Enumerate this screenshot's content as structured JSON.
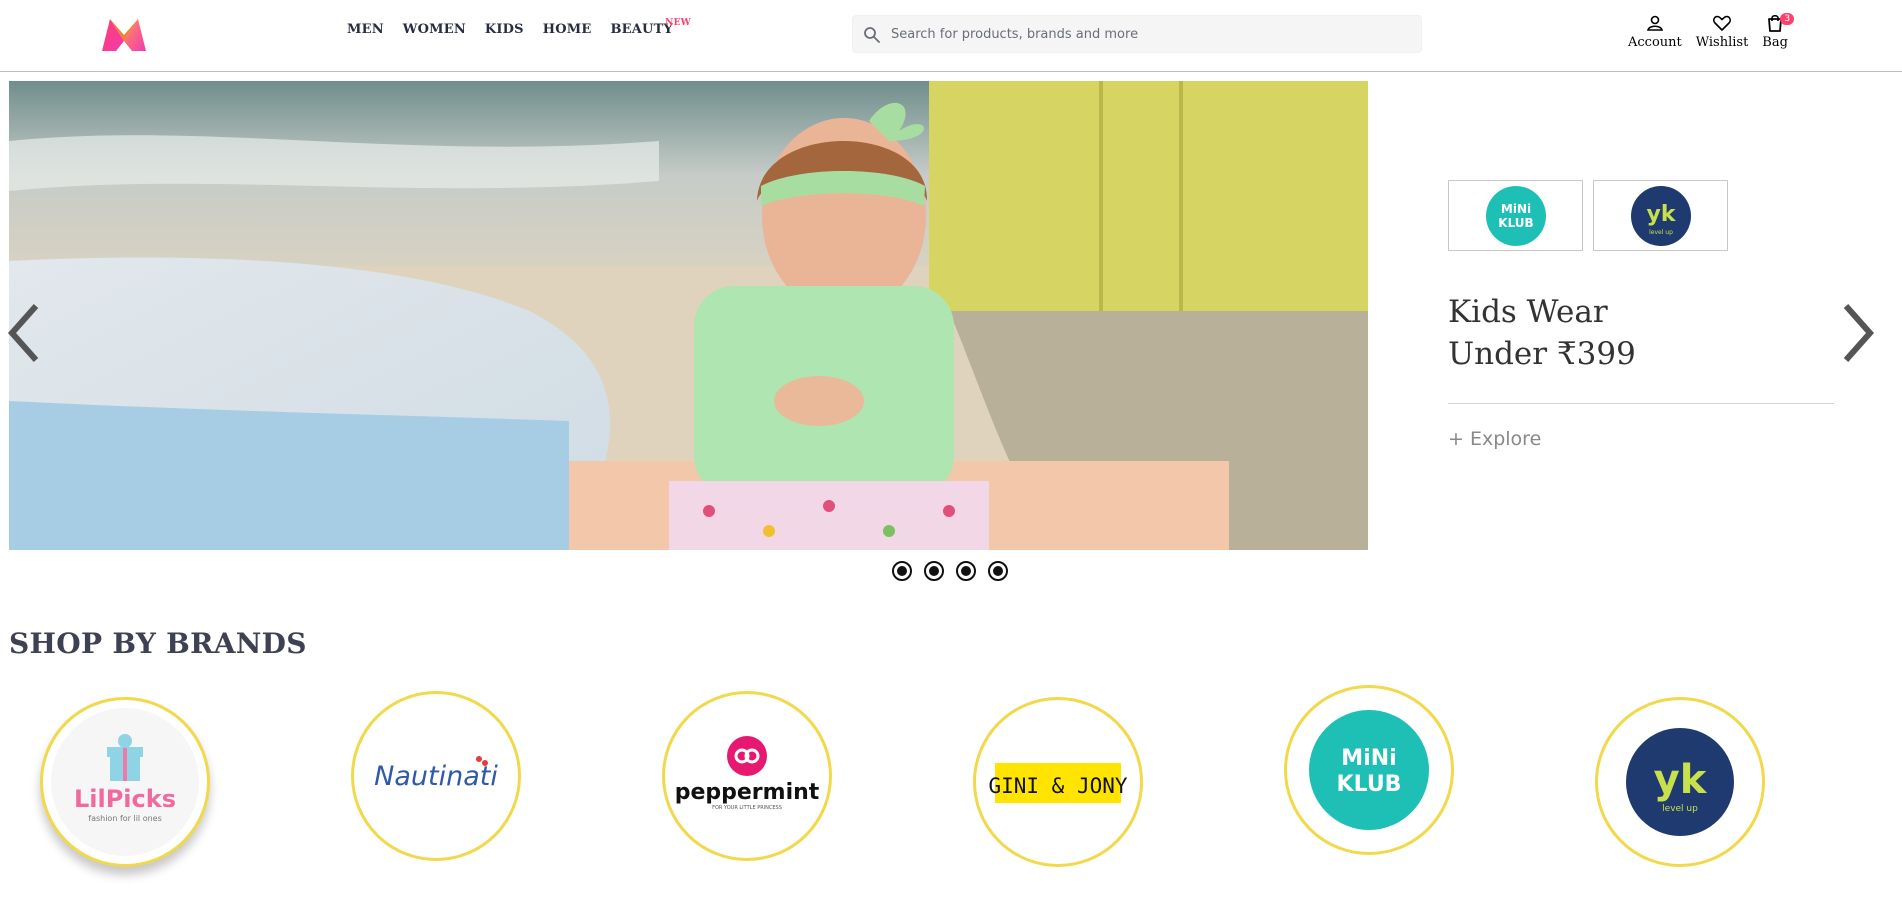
{
  "header": {
    "nav": [
      {
        "label": "MEN"
      },
      {
        "label": "WOMEN"
      },
      {
        "label": "KIDS"
      },
      {
        "label": "HOME"
      },
      {
        "label": "BEAUTY",
        "badge": "NEW"
      }
    ],
    "search": {
      "placeholder": "Search for products, brands and more",
      "value": ""
    },
    "actions": {
      "account": "Account",
      "wishlist": "Wishlist",
      "bag": "Bag",
      "bag_count": "3"
    }
  },
  "hero": {
    "promo_line1": "Kids Wear",
    "promo_line2": "Under ₹399",
    "explore": "+ Explore",
    "slide_count": 4,
    "thumb_brands": [
      "mini-klub-logo",
      "yk-logo"
    ]
  },
  "section": {
    "title": "SHOP BY BRANDS"
  },
  "brands": [
    {
      "name": "LilPicks",
      "tagline": "fashion for lil ones"
    },
    {
      "name": "Nautinati"
    },
    {
      "name": "peppermint",
      "tagline": "FOR YOUR LITTLE PRINCESS"
    },
    {
      "name": "GINI & JONY"
    },
    {
      "name": "MINI KLUB"
    },
    {
      "name": "YK",
      "tagline": "level up"
    }
  ],
  "colors": {
    "accent": "#ff3f6c",
    "brand_ring": "#f2d84b",
    "mini_klub": "#1ec0b6",
    "yk_bg": "#1f3a6e",
    "yk_fg": "#c8e04b"
  }
}
